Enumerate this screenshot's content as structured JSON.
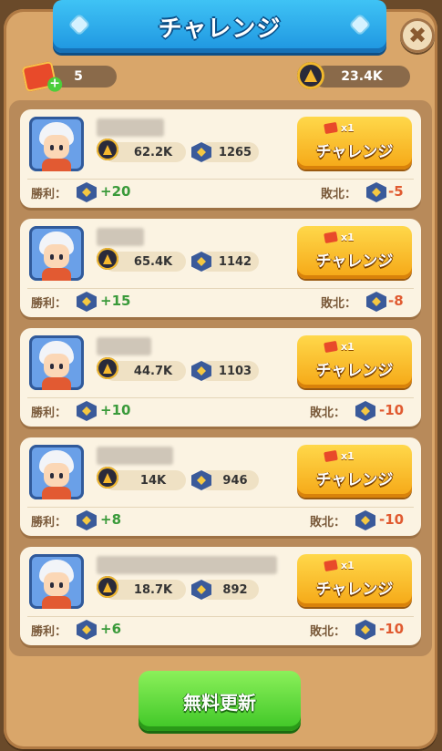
{
  "header": {
    "title": "チャレンジ",
    "close_icon": "close-icon"
  },
  "resources": {
    "tickets": "5",
    "trophies": "23.4K"
  },
  "labels": {
    "win": "勝利：",
    "lose": "敗北：",
    "challenge": "チャレンジ",
    "cost": "x1"
  },
  "opponents": [
    {
      "power": "62.2K",
      "rating": "1265",
      "win": "+20",
      "lose": "-5"
    },
    {
      "power": "65.4K",
      "rating": "1142",
      "win": "+15",
      "lose": "-8"
    },
    {
      "power": "44.7K",
      "rating": "1103",
      "win": "+10",
      "lose": "-10"
    },
    {
      "power": "14K",
      "rating": "946",
      "win": "+8",
      "lose": "-10"
    },
    {
      "power": "18.7K",
      "rating": "892",
      "win": "+6",
      "lose": "-10"
    }
  ],
  "footer": {
    "refresh_label": "無料更新"
  },
  "colors": {
    "accent_blue": "#1e95e0",
    "button_orange": "#f5a716",
    "button_green": "#3ec626",
    "win_green": "#3a9a3a",
    "lose_red": "#e05a30"
  }
}
